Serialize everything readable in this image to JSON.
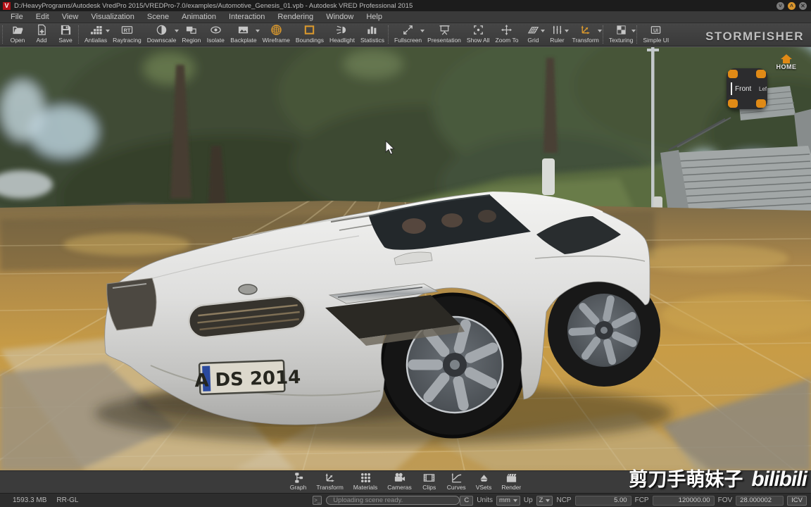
{
  "window": {
    "title": "D:/HeavyPrograms/Autodesk VredPro 2015/VREDPro-7.0/examples/Automotive_Genesis_01.vpb - Autodesk VRED Professional 2015",
    "logo_letter": "V",
    "controls": {
      "minimize": "˅",
      "maximize": "˄",
      "close": "✕"
    }
  },
  "menu": {
    "items": [
      "File",
      "Edit",
      "View",
      "Visualization",
      "Scene",
      "Animation",
      "Interaction",
      "Rendering",
      "Window",
      "Help"
    ]
  },
  "toolbar": {
    "watermark": "STORMFISHER",
    "accent_color": "#d9982d",
    "buttons": [
      {
        "label": "Open",
        "icon": "folder-open-icon"
      },
      {
        "label": "Add",
        "icon": "add-file-icon"
      },
      {
        "label": "Save",
        "icon": "save-icon"
      },
      {
        "label": "Antialias",
        "icon": "antialias-icon",
        "dropdown": true
      },
      {
        "label": "Raytracing",
        "icon": "raytracing-icon"
      },
      {
        "label": "Downscale",
        "icon": "downscale-icon",
        "dropdown": true
      },
      {
        "label": "Region",
        "icon": "region-icon"
      },
      {
        "label": "Isolate",
        "icon": "isolate-icon"
      },
      {
        "label": "Backplate",
        "icon": "backplate-icon",
        "dropdown": true
      },
      {
        "label": "Wireframe",
        "icon": "wireframe-icon",
        "accent": true
      },
      {
        "label": "Boundings",
        "icon": "boundings-icon",
        "accent": true
      },
      {
        "label": "Headlight",
        "icon": "headlight-icon"
      },
      {
        "label": "Statistics",
        "icon": "statistics-icon"
      },
      {
        "label": "Fullscreen",
        "icon": "fullscreen-icon",
        "dropdown": true
      },
      {
        "label": "Presentation",
        "icon": "presentation-icon"
      },
      {
        "label": "Show All",
        "icon": "show-all-icon"
      },
      {
        "label": "Zoom To",
        "icon": "zoom-to-icon"
      },
      {
        "label": "Grid",
        "icon": "grid-icon",
        "dropdown": true
      },
      {
        "label": "Ruler",
        "icon": "ruler-icon",
        "dropdown": true
      },
      {
        "label": "Transform",
        "icon": "transform-icon",
        "accent": true,
        "dropdown": true
      },
      {
        "label": "Texturing",
        "icon": "texturing-icon",
        "dropdown": true
      },
      {
        "label": "Simple UI",
        "icon": "simple-ui-icon"
      }
    ]
  },
  "viewport": {
    "navcube": {
      "front": "Front",
      "left": "Left",
      "home": "HOME"
    },
    "license_plate": "A DS 2014",
    "watermark_cn": "剪刀手萌妹子",
    "watermark_logo": "bilibili"
  },
  "dock": {
    "buttons": [
      {
        "label": "Graph",
        "icon": "graph-icon"
      },
      {
        "label": "Transform",
        "icon": "transform-gray-icon"
      },
      {
        "label": "Materials",
        "icon": "materials-icon"
      },
      {
        "label": "Cameras",
        "icon": "cameras-icon"
      },
      {
        "label": "Clips",
        "icon": "clips-icon"
      },
      {
        "label": "Curves",
        "icon": "curves-icon"
      },
      {
        "label": "VSets",
        "icon": "vsets-icon"
      },
      {
        "label": "Render",
        "icon": "render-icon"
      }
    ]
  },
  "status": {
    "memory": "1593.3 MB",
    "renderer": "RR-GL",
    "progress_text": "Uploading scene ready.",
    "c_button": "C",
    "units_label": "Units",
    "units_value": "mm",
    "up_label": "Up",
    "up_value": "Z",
    "ncp_label": "NCP",
    "ncp_value": "5.00",
    "fcp_label": "FCP",
    "fcp_value": "120000.00",
    "fov_label": "FOV",
    "fov_value": "28.000002",
    "icv_button": "ICV"
  }
}
